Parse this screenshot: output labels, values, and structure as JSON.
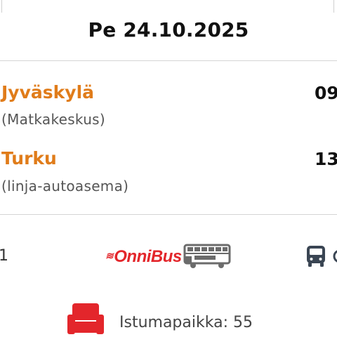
{
  "header": {
    "date": "Pe 24.10.2025"
  },
  "route": {
    "departure": {
      "city": "Jyväskylä",
      "station": "(Matkakeskus)",
      "time": "09"
    },
    "arrival": {
      "city": "Turku",
      "station": "(linja-autoasema)",
      "time": "13"
    }
  },
  "operator": {
    "left_number": "1",
    "brand": "OnniBus",
    "icons": [
      "double-decker-bus-icon",
      "bus-front-icon"
    ]
  },
  "seat": {
    "label": "Istumapaikka: 55",
    "icon": "seat-icon"
  },
  "colors": {
    "accent": "#e07c1a",
    "brand_red": "#e3262b",
    "icon_gray": "#6b6b6b",
    "bus_navy": "#3a4553"
  }
}
